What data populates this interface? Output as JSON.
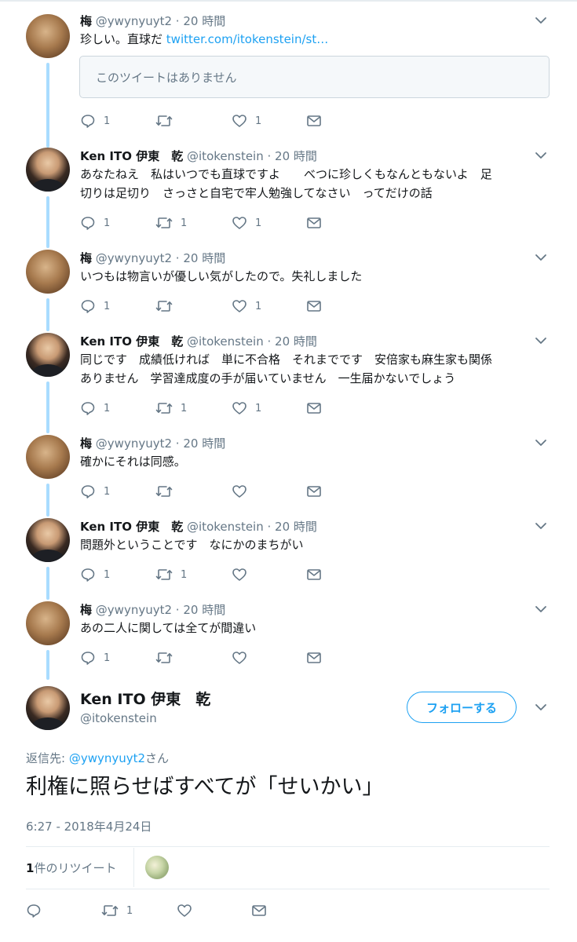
{
  "tweets": [
    {
      "name": "梅",
      "handle": "@ywynyuyt2",
      "time": "· 20 時間",
      "text": "珍しい。直球だ",
      "link": "twitter.com/itokenstein/st…",
      "quote": "このツイートはありません",
      "reply_count": "1",
      "retweet_count": "",
      "like_count": "1"
    },
    {
      "name": "Ken ITO 伊東　乾",
      "handle": "@itokenstein",
      "time": "· 20 時間",
      "text_line1": "あなたねえ　私はいつでも直球ですよ　　べつに珍しくもなんともないよ　足",
      "text_line2": "切りは足切り　さっさと自宅で牢人勉強してなさい　ってだけの話",
      "reply_count": "1",
      "retweet_count": "1",
      "like_count": "1"
    },
    {
      "name": "梅",
      "handle": "@ywynyuyt2",
      "time": "· 20 時間",
      "text": "いつもは物言いが優しい気がしたので。失礼しました",
      "reply_count": "1",
      "retweet_count": "",
      "like_count": "1"
    },
    {
      "name": "Ken ITO 伊東　乾",
      "handle": "@itokenstein",
      "time": "· 20 時間",
      "text_line1": "同じです　成績低ければ　単に不合格　それまでです　安倍家も麻生家も関係",
      "text_line2": "ありません　学習達成度の手が届いていません　一生届かないでしょう",
      "reply_count": "1",
      "retweet_count": "1",
      "like_count": "1"
    },
    {
      "name": "梅",
      "handle": "@ywynyuyt2",
      "time": "· 20 時間",
      "text": "確かにそれは同感。",
      "reply_count": "1",
      "retweet_count": "",
      "like_count": ""
    },
    {
      "name": "Ken ITO 伊東　乾",
      "handle": "@itokenstein",
      "time": "· 20 時間",
      "text": "問題外ということです　なにかのまちがい",
      "reply_count": "1",
      "retweet_count": "1",
      "like_count": ""
    },
    {
      "name": "梅",
      "handle": "@ywynyuyt2",
      "time": "· 20 時間",
      "text": "あの二人に関しては全てが間違い",
      "reply_count": "1",
      "retweet_count": "",
      "like_count": ""
    }
  ],
  "main_tweet": {
    "name": "Ken ITO 伊東　乾",
    "handle": "@itokenstein",
    "follow_label": "フォローする",
    "reply_to_prefix": "返信先: ",
    "reply_to_handle": "@ywynyuyt2",
    "reply_to_suffix": "さん",
    "text": "利権に照らせばすべてが「せいかい」",
    "timestamp": "6:27 - 2018年4月24日",
    "retweet_stat_count": "1",
    "retweet_stat_label": "件のリツイート",
    "reply_count": "",
    "retweet_count": "1",
    "like_count": ""
  },
  "icons": {
    "reply": "reply-icon",
    "retweet": "retweet-icon",
    "like": "heart-icon",
    "dm": "envelope-icon",
    "caret": "chevron-down-icon"
  },
  "colors": {
    "accent": "#1da1f2",
    "thread_line": "#a9dcff",
    "secondary_text": "#657786"
  }
}
